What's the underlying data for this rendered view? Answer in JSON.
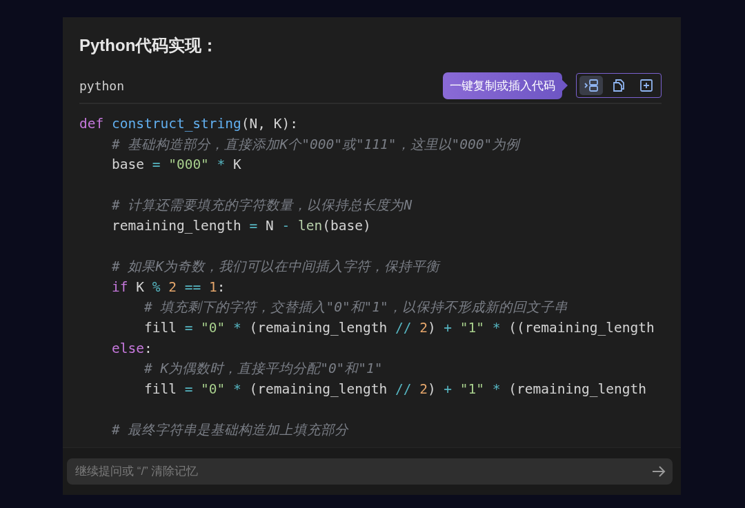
{
  "heading": "Python代码实现：",
  "code_block": {
    "language": "python",
    "tooltip": "一键复制或插入代码",
    "actions": [
      {
        "kind": "insert",
        "hovered": true
      },
      {
        "kind": "copy",
        "hovered": false
      },
      {
        "kind": "add",
        "hovered": false
      }
    ],
    "lines": [
      {
        "blank_before": false,
        "tokens": [
          {
            "kind": "kw",
            "text": "def "
          },
          {
            "kind": "fn",
            "text": "construct_string"
          },
          {
            "kind": "plain",
            "text": "(N, K):"
          }
        ]
      },
      {
        "blank_before": false,
        "tokens": [
          {
            "kind": "cm",
            "text": "    # 基础构造部分，直接添加K个\"000\"或\"111\"，这里以\"000\"为例"
          }
        ]
      },
      {
        "blank_before": false,
        "tokens": [
          {
            "kind": "plain",
            "text": "    base "
          },
          {
            "kind": "op",
            "text": "= "
          },
          {
            "kind": "str",
            "text": "\"000\" "
          },
          {
            "kind": "op",
            "text": "* "
          },
          {
            "kind": "plain",
            "text": "K"
          }
        ]
      },
      {
        "blank_before": true,
        "tokens": [
          {
            "kind": "cm",
            "text": "    # 计算还需要填充的字符数量，以保持总长度为N"
          }
        ]
      },
      {
        "blank_before": false,
        "tokens": [
          {
            "kind": "plain",
            "text": "    remaining_length "
          },
          {
            "kind": "op",
            "text": "= "
          },
          {
            "kind": "plain",
            "text": "N "
          },
          {
            "kind": "op",
            "text": "- "
          },
          {
            "kind": "builtin",
            "text": "len"
          },
          {
            "kind": "plain",
            "text": "(base)"
          }
        ]
      },
      {
        "blank_before": true,
        "tokens": [
          {
            "kind": "cm",
            "text": "    # 如果K为奇数，我们可以在中间插入字符，保持平衡"
          }
        ]
      },
      {
        "blank_before": false,
        "tokens": [
          {
            "kind": "kw",
            "text": "    if"
          },
          {
            "kind": "plain",
            "text": " K "
          },
          {
            "kind": "op",
            "text": "% "
          },
          {
            "kind": "num",
            "text": "2 "
          },
          {
            "kind": "op",
            "text": "== "
          },
          {
            "kind": "num",
            "text": "1"
          },
          {
            "kind": "plain",
            "text": ":"
          }
        ]
      },
      {
        "blank_before": false,
        "tokens": [
          {
            "kind": "cm",
            "text": "        # 填充剩下的字符，交替插入\"0\"和\"1\"，以保持不形成新的回文子串"
          }
        ]
      },
      {
        "blank_before": false,
        "tokens": [
          {
            "kind": "plain",
            "text": "        fill "
          },
          {
            "kind": "op",
            "text": "= "
          },
          {
            "kind": "str",
            "text": "\"0\" "
          },
          {
            "kind": "op",
            "text": "* "
          },
          {
            "kind": "plain",
            "text": "(remaining_length "
          },
          {
            "kind": "op",
            "text": "// "
          },
          {
            "kind": "num",
            "text": "2"
          },
          {
            "kind": "plain",
            "text": ") "
          },
          {
            "kind": "op",
            "text": "+ "
          },
          {
            "kind": "str",
            "text": "\"1\" "
          },
          {
            "kind": "op",
            "text": "* "
          },
          {
            "kind": "plain",
            "text": "((remaining_length"
          }
        ]
      },
      {
        "blank_before": false,
        "tokens": [
          {
            "kind": "kw",
            "text": "    else"
          },
          {
            "kind": "plain",
            "text": ":"
          }
        ]
      },
      {
        "blank_before": false,
        "tokens": [
          {
            "kind": "cm",
            "text": "        # K为偶数时，直接平均分配\"0\"和\"1\""
          }
        ]
      },
      {
        "blank_before": false,
        "tokens": [
          {
            "kind": "plain",
            "text": "        fill "
          },
          {
            "kind": "op",
            "text": "= "
          },
          {
            "kind": "str",
            "text": "\"0\" "
          },
          {
            "kind": "op",
            "text": "* "
          },
          {
            "kind": "plain",
            "text": "(remaining_length "
          },
          {
            "kind": "op",
            "text": "// "
          },
          {
            "kind": "num",
            "text": "2"
          },
          {
            "kind": "plain",
            "text": ") "
          },
          {
            "kind": "op",
            "text": "+ "
          },
          {
            "kind": "str",
            "text": "\"1\" "
          },
          {
            "kind": "op",
            "text": "* "
          },
          {
            "kind": "plain",
            "text": "(remaining_length"
          }
        ]
      },
      {
        "blank_before": true,
        "tokens": [
          {
            "kind": "cm",
            "text": "    # 最终字符串是基础构造加上填充部分"
          }
        ]
      }
    ]
  },
  "input": {
    "placeholder": "继续提问或 “/” 清除记忆"
  }
}
